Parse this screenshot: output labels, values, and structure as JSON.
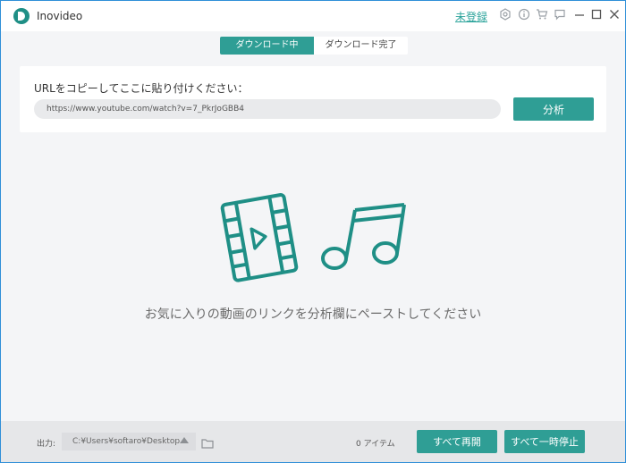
{
  "app": {
    "title": "Inovideo",
    "register_link": "未登録"
  },
  "titlebar": {
    "icons": [
      "settings-icon",
      "info-icon",
      "cart-icon",
      "chat-icon",
      "minimize-icon",
      "maximize-icon",
      "close-icon"
    ]
  },
  "tabs": [
    {
      "label": "ダウンロード中",
      "active": true
    },
    {
      "label": "ダウンロード完了",
      "active": false
    }
  ],
  "url_panel": {
    "label": "URLをコピーしてここに貼り付けください：",
    "input_value": "https://www.youtube.com/watch?v=7_PkrJoGBB4",
    "analyze_button": "分析"
  },
  "empty_state": {
    "hint": "お気に入りの動画のリンクを分析欄にペーストしてください"
  },
  "bottom": {
    "output_label": "出力:",
    "output_path": "C:¥Users¥softaro¥Desktop",
    "item_count": "0 アイテム",
    "resume_all": "すべて再開",
    "pause_all": "すべて一時停止"
  },
  "colors": {
    "accent": "#2f9e95",
    "window_border": "#2f8fd8"
  }
}
